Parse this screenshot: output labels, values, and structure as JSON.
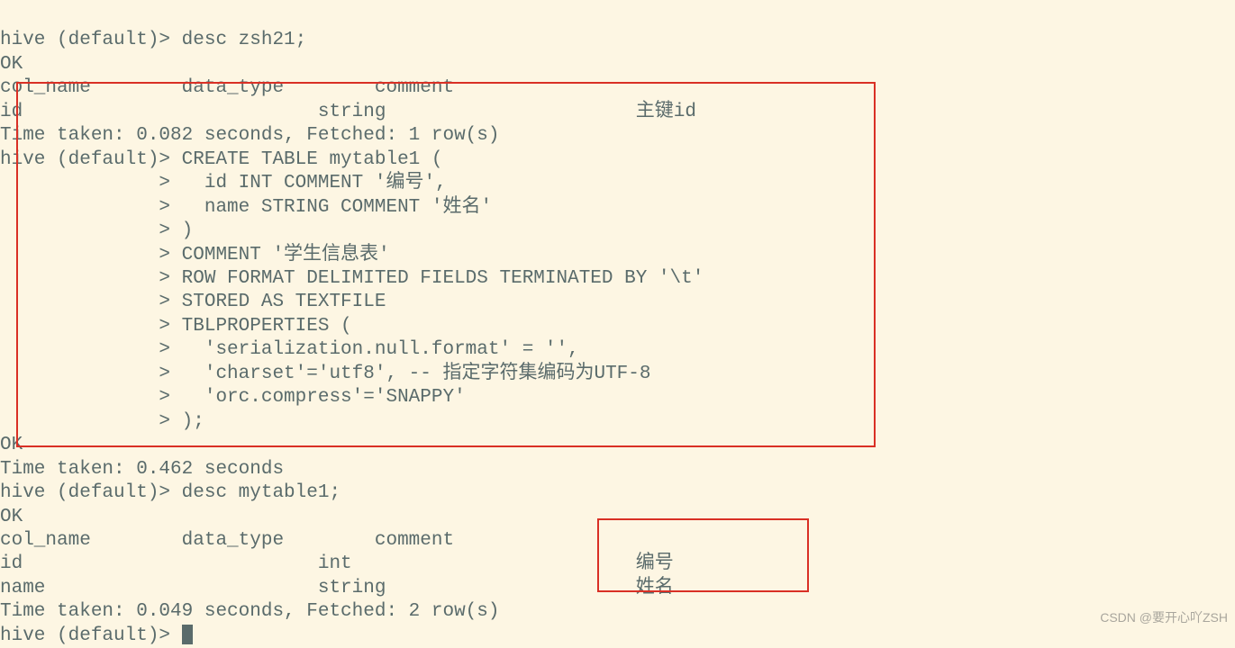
{
  "lines": {
    "l01": "hive (default)> desc zsh21;",
    "l02": "OK",
    "l03": "col_name        data_type        comment",
    "l04": "id                          string                      主键id",
    "l05": "Time taken: 0.082 seconds, Fetched: 1 row(s)",
    "l06": "hive (default)> CREATE TABLE mytable1 (",
    "l07": "              >   id INT COMMENT '编号',",
    "l08": "              >   name STRING COMMENT '姓名'",
    "l09": "              > )",
    "l10": "              > COMMENT '学生信息表'",
    "l11": "              > ROW FORMAT DELIMITED FIELDS TERMINATED BY '\\t'",
    "l12": "              > STORED AS TEXTFILE",
    "l13": "              > TBLPROPERTIES (",
    "l14": "              >   'serialization.null.format' = '',",
    "l15": "              >   'charset'='utf8', -- 指定字符集编码为UTF-8",
    "l16": "              >   'orc.compress'='SNAPPY'",
    "l17": "              > );",
    "l18": "OK",
    "l19": "Time taken: 0.462 seconds",
    "l20": "hive (default)> desc mytable1;",
    "l21": "OK",
    "l22": "col_name        data_type        comment",
    "l23": "id                          int                         编号",
    "l24": "name                        string                      姓名",
    "l25": "Time taken: 0.049 seconds, Fetched: 2 row(s)",
    "l26": "hive (default)> "
  },
  "watermark": "CSDN @要开心吖ZSH"
}
